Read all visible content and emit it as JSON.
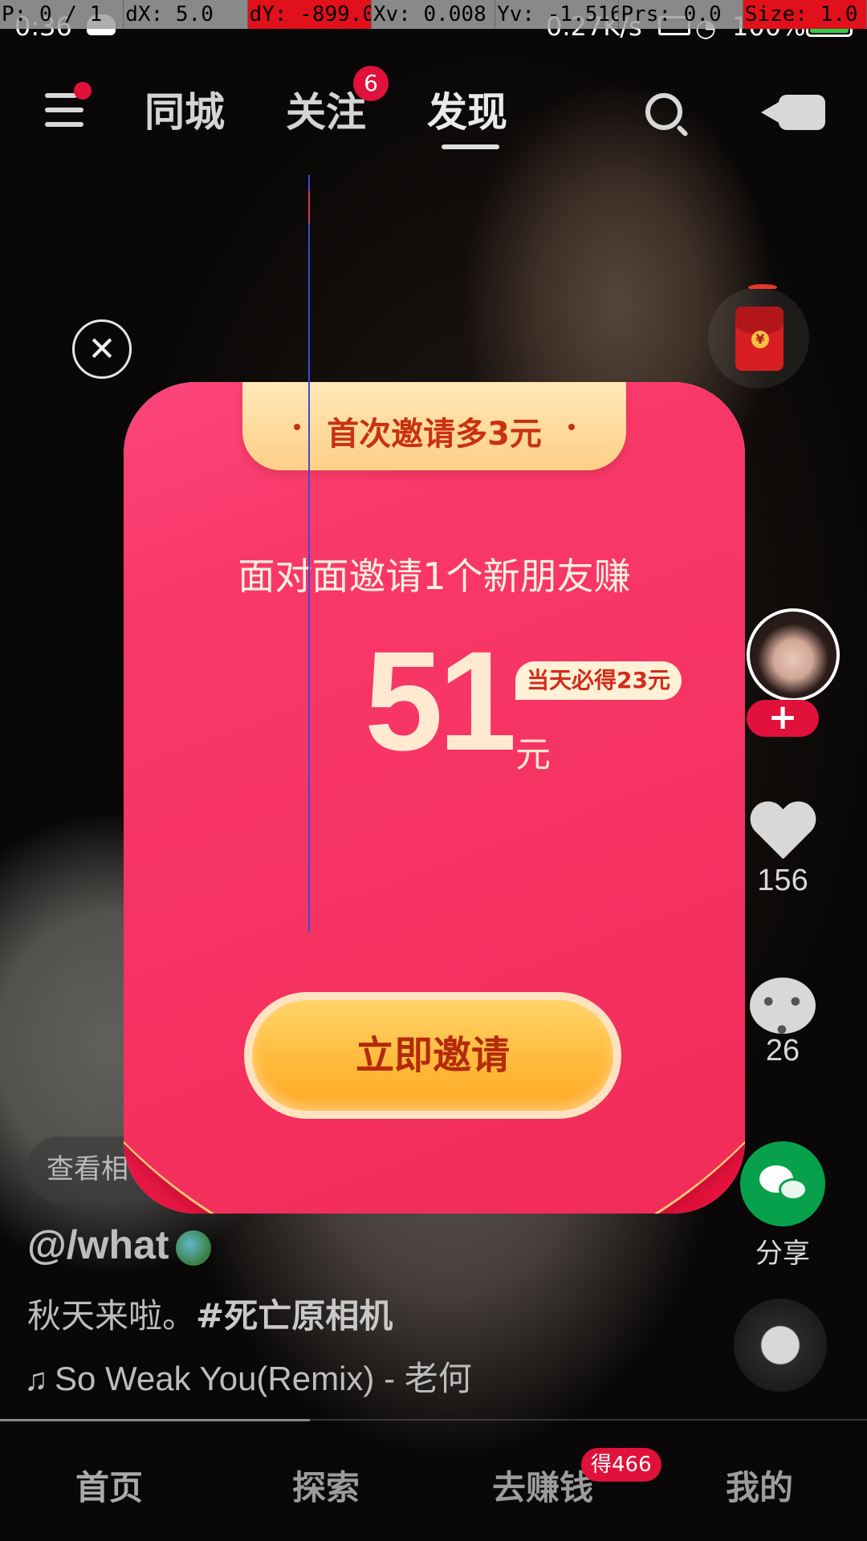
{
  "debug": {
    "pointer": "P: 0 / 1",
    "dx": "dX: 5.0",
    "dy": "dY: -899.0",
    "xv": "Xv: 0.008",
    "yv": "Yv: -1.516",
    "prs": "Prs: 0.0",
    "size": "Size: 1.0"
  },
  "status_bar": {
    "time": "0:36",
    "net_speed": "0.27K/s",
    "battery": "100%"
  },
  "top_nav": {
    "tabs": [
      "同城",
      "关注",
      "发现"
    ],
    "active_tab": "发现",
    "follow_badge": "6"
  },
  "modal": {
    "ribbon": "首次邀请多3元",
    "headline": "面对面邀请1个新朋友赚",
    "amount": "51",
    "unit": "元",
    "daily_badge": "当天必得23元",
    "cta": "立即邀请",
    "close_symbol": "✕"
  },
  "side_actions": {
    "likes": "156",
    "comments": "26",
    "share_label": "分享",
    "follow_plus": "+"
  },
  "post": {
    "related_pill": "查看相",
    "author": "@/what",
    "caption_text": "秋天来啦。",
    "caption_tag": "#死亡原相机",
    "music": "So Weak You(Remix) - 老何"
  },
  "bottom_tabs": {
    "items": [
      "首页",
      "探索",
      "去赚钱",
      "我的"
    ],
    "earn_badge": "得466"
  },
  "colors": {
    "accent_red": "#e0113b",
    "modal_gold": "#ffbb3c",
    "wechat_green": "#07a14c"
  }
}
